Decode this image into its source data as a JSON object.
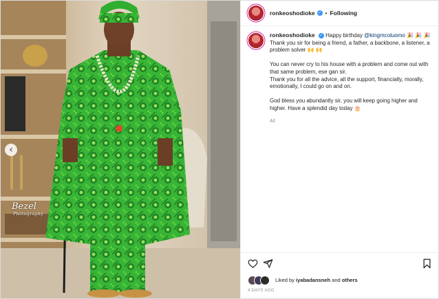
{
  "header": {
    "username": "ronkeoshodioke",
    "separator": "•",
    "follow_status": "Following"
  },
  "caption": {
    "username": "ronkeoshodioke",
    "lines": [
      {
        "pre": "Happy birthday ",
        "mention": "@kingmcoluomo",
        "post": " 🎉 🎉 🎉"
      },
      {
        "text": "Thank you sir for being a friend, a father, a backbone, a listener, a problem solver 🙌 🙌"
      },
      {
        "text": "You can never cry to his house with a problem and come out with that same problem, ese gan sir."
      },
      {
        "text": "Thank you for all the advice, all the support, financially, morally, emotionally, I could go on and on."
      },
      {
        "text": "God bless you abundantly sir, you will keep going higher and higher. Have a splendid day today 🎂"
      }
    ],
    "time": "4d"
  },
  "likes": {
    "prefix": "Liked by",
    "user": "iyabadansneh",
    "connector": "and",
    "others": "others"
  },
  "post_date": "4 DAYS AGO",
  "media": {
    "watermark": "Bezel",
    "watermark_sub": "Photography",
    "prev_glyph": "‹"
  },
  "icons": {
    "like": "heart-icon",
    "share": "share-icon",
    "save": "bookmark-icon",
    "verified": "verified-badge-icon"
  },
  "colors": {
    "verified": "#3897f0",
    "mention": "#00376b",
    "agbada_green": "#2fae2f"
  }
}
